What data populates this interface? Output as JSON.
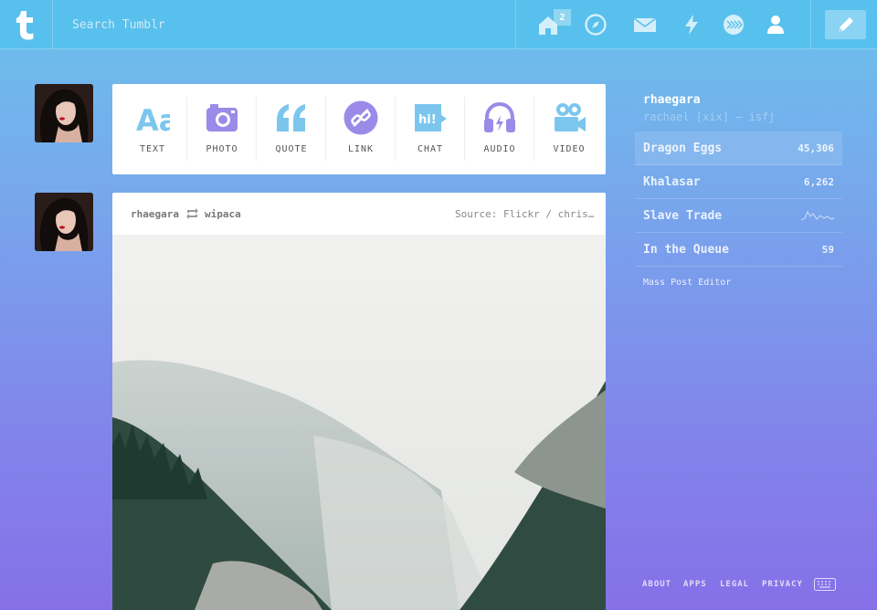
{
  "header": {
    "search_placeholder": "Search Tumblr",
    "notification_count": "2",
    "icons": [
      "home-icon",
      "compass-icon",
      "mail-icon",
      "lightning-icon",
      "staff-icon",
      "account-icon",
      "compose-icon"
    ]
  },
  "post_types": [
    {
      "label": "TEXT",
      "icon": "text-icon",
      "color": "#7cc6ee"
    },
    {
      "label": "PHOTO",
      "icon": "camera-icon",
      "color": "#9b8ae8"
    },
    {
      "label": "QUOTE",
      "icon": "quote-icon",
      "color": "#7cc6ee"
    },
    {
      "label": "LINK",
      "icon": "link-icon",
      "color": "#9b8ae8"
    },
    {
      "label": "CHAT",
      "icon": "chat-icon",
      "color": "#7cc6ee"
    },
    {
      "label": "AUDIO",
      "icon": "headphones-icon",
      "color": "#9b8ae8"
    },
    {
      "label": "VIDEO",
      "icon": "video-camera-icon",
      "color": "#7cc6ee"
    }
  ],
  "post": {
    "author": "rhaegara",
    "reblogged_from": "wipaca",
    "source": "Source: Flickr / chris…"
  },
  "sidebar": {
    "blog_name": "rhaegara",
    "blog_subtitle": "rachael [xix] — isfj",
    "rows": [
      {
        "label": "Dragon Eggs",
        "value": "45,306"
      },
      {
        "label": "Khalasar",
        "value": "6,262"
      },
      {
        "label": "Slave Trade",
        "value": ""
      },
      {
        "label": "In the Queue",
        "value": "59"
      }
    ],
    "mass_post_editor": "Mass Post Editor"
  },
  "footer": {
    "about": "ABOUT",
    "apps": "APPS",
    "legal": "LEGAL",
    "privacy": "PRIVACY"
  },
  "colors": {
    "header": "#58c0ec",
    "accent_blue": "#7cc6ee",
    "accent_purple": "#9b8ae8"
  }
}
